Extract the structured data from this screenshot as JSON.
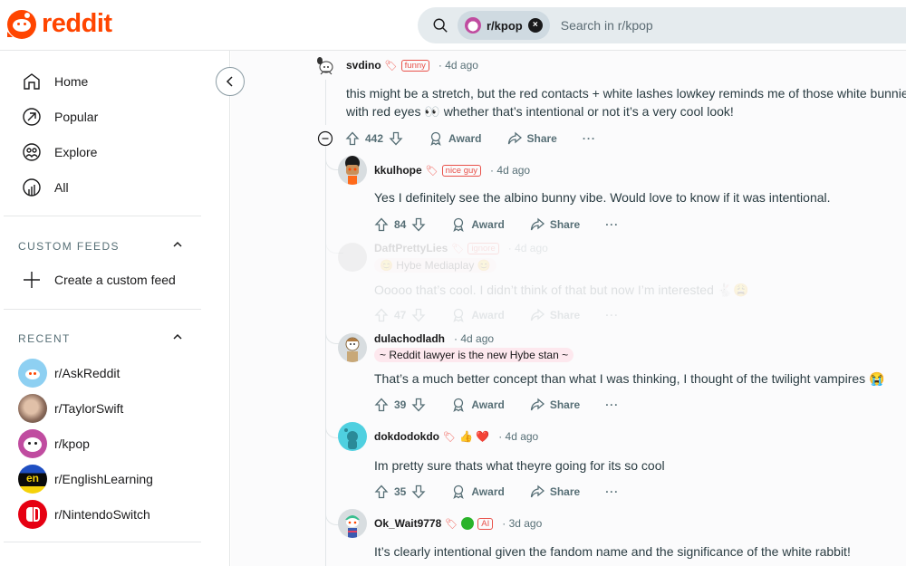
{
  "header": {
    "logo_text": "reddit",
    "search": {
      "icon": "search-icon",
      "chip_label": "r/kpop",
      "chip_close": "×",
      "placeholder": "Search in r/kpop"
    }
  },
  "sidebar": {
    "nav": [
      {
        "label": "Home",
        "icon": "home-icon"
      },
      {
        "label": "Popular",
        "icon": "popular-arrow-icon"
      },
      {
        "label": "Explore",
        "icon": "explore-people-icon"
      },
      {
        "label": "All",
        "icon": "all-chart-icon"
      }
    ],
    "custom_feeds": {
      "title": "CUSTOM FEEDS",
      "create_label": "Create a custom feed"
    },
    "recent": {
      "title": "RECENT",
      "items": [
        {
          "label": "r/AskReddit",
          "color": "#8ed0f2"
        },
        {
          "label": "r/TaylorSwift",
          "color": "#8a6a5a"
        },
        {
          "label": "r/kpop",
          "color": "#c04ca0"
        },
        {
          "label": "r/EnglishLearning",
          "color": "#0a0a0a"
        },
        {
          "label": "r/NintendoSwitch",
          "color": "#e60012"
        }
      ]
    }
  },
  "comments": [
    {
      "user": "svdino",
      "flair": "funny",
      "time": "4d ago",
      "body": "this might be a stretch, but the red contacts + white lashes lowkey reminds me of those white bunnies",
      "body2": "with red eyes 👀 whether that’s intentional or not it’s a very cool look!",
      "votes": "442",
      "award": "Award",
      "share": "Share",
      "more": "···"
    },
    {
      "user": "kkulhope",
      "flair": "nice guy",
      "time": "4d ago",
      "body": "Yes I definitely see the albino bunny vibe. Would love to know if it was intentional.",
      "votes": "84",
      "award": "Award",
      "share": "Share",
      "more": "···"
    },
    {
      "user": "DaftPrettyLies",
      "flair": "ignore",
      "user_flair": "😊 Hybe Mediaplay 😊",
      "time": "4d ago",
      "body": "Ooooo that’s cool. I didn’t think of that but now I’m interested 🐇😩",
      "votes": "47",
      "award": "Award",
      "share": "Share",
      "more": "···"
    },
    {
      "user": "dulachodladh",
      "user_flair": "~ Reddit lawyer is the new Hybe stan ~",
      "time": "4d ago",
      "body": "That’s a much better concept than what I was thinking, I thought of the twilight vampires 😭",
      "votes": "39",
      "award": "Award",
      "share": "Share",
      "more": "···"
    },
    {
      "user": "dokdodokdo",
      "badges": "👍 ❤️",
      "time": "4d ago",
      "body": "Im pretty sure thats what theyre going for its so cool",
      "votes": "35",
      "award": "Award",
      "share": "Share",
      "more": "···"
    },
    {
      "user": "Ok_Wait9778",
      "flair": "AI",
      "time": "3d ago",
      "body": "It’s clearly intentional given the fandom name and the significance of the white rabbit!"
    }
  ],
  "colors": {
    "brand": "#ff4500",
    "flair_red": "#e8514a",
    "muted_text": "#576f76"
  }
}
